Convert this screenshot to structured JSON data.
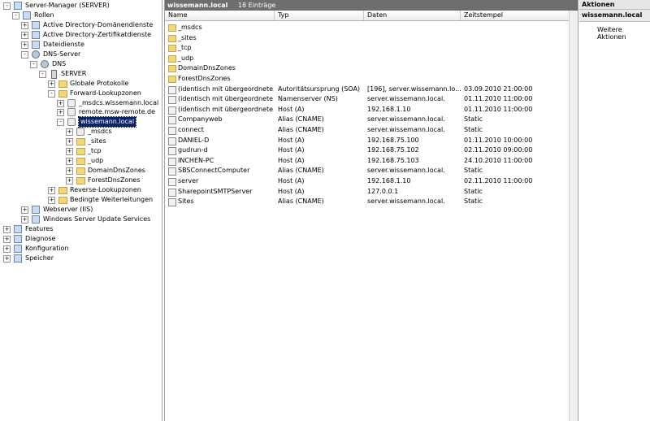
{
  "tree": [
    {
      "label": "Server-Manager (SERVER)",
      "depth": 0,
      "expander": "-",
      "icon": "server-manager-icon"
    },
    {
      "label": "Rollen",
      "depth": 1,
      "expander": "-",
      "icon": "roles-icon"
    },
    {
      "label": "Active Directory-Domänendienste",
      "depth": 2,
      "expander": "+",
      "icon": "ad-ds-icon"
    },
    {
      "label": "Active Directory-Zertifikatdienste",
      "depth": 2,
      "expander": "+",
      "icon": "ad-cs-icon"
    },
    {
      "label": "Dateidienste",
      "depth": 2,
      "expander": "+",
      "icon": "file-services-icon"
    },
    {
      "label": "DNS-Server",
      "depth": 2,
      "expander": "-",
      "icon": "dns-server-icon"
    },
    {
      "label": "DNS",
      "depth": 3,
      "expander": "-",
      "icon": "dns-icon"
    },
    {
      "label": "SERVER",
      "depth": 4,
      "expander": "-",
      "icon": "server-icon"
    },
    {
      "label": "Globale Protokolle",
      "depth": 5,
      "expander": "+",
      "icon": "logs-folder-icon"
    },
    {
      "label": "Forward-Lookupzonen",
      "depth": 5,
      "expander": "-",
      "icon": "folder-icon"
    },
    {
      "label": "_msdcs.wissemann.local",
      "depth": 6,
      "expander": "+",
      "icon": "zone-icon"
    },
    {
      "label": "remote.msw-remote.de",
      "depth": 6,
      "expander": "+",
      "icon": "zone-icon"
    },
    {
      "label": "wissemann.local",
      "depth": 6,
      "expander": "-",
      "icon": "zone-icon",
      "selected": true
    },
    {
      "label": "_msdcs",
      "depth": 7,
      "expander": "+",
      "icon": "zone-icon"
    },
    {
      "label": "_sites",
      "depth": 7,
      "expander": "+",
      "icon": "folder-icon"
    },
    {
      "label": "_tcp",
      "depth": 7,
      "expander": "+",
      "icon": "folder-icon"
    },
    {
      "label": "_udp",
      "depth": 7,
      "expander": "+",
      "icon": "folder-icon"
    },
    {
      "label": "DomainDnsZones",
      "depth": 7,
      "expander": "+",
      "icon": "folder-icon"
    },
    {
      "label": "ForestDnsZones",
      "depth": 7,
      "expander": "+",
      "icon": "folder-icon"
    },
    {
      "label": "Reverse-Lookupzonen",
      "depth": 5,
      "expander": "+",
      "icon": "folder-icon"
    },
    {
      "label": "Bedingte Weiterleitungen",
      "depth": 5,
      "expander": "+",
      "icon": "folder-icon"
    },
    {
      "label": "Webserver (IIS)",
      "depth": 2,
      "expander": "+",
      "icon": "iis-icon"
    },
    {
      "label": "Windows Server Update Services",
      "depth": 2,
      "expander": "+",
      "icon": "wsus-icon"
    },
    {
      "label": "Features",
      "depth": 0,
      "expander": "+",
      "icon": "features-icon"
    },
    {
      "label": "Diagnose",
      "depth": 0,
      "expander": "+",
      "icon": "diagnostics-icon"
    },
    {
      "label": "Konfiguration",
      "depth": 0,
      "expander": "+",
      "icon": "configuration-icon"
    },
    {
      "label": "Speicher",
      "depth": 0,
      "expander": "+",
      "icon": "storage-icon"
    }
  ],
  "main": {
    "title": "wissemann.local",
    "count": "18 Einträge",
    "columns": [
      "Name",
      "Typ",
      "Daten",
      "Zeitstempel"
    ],
    "rows": [
      {
        "icon": "folder-icon",
        "kind": "folder",
        "name": "_msdcs",
        "typ": "",
        "daten": "",
        "zeit": ""
      },
      {
        "icon": "folder-icon",
        "kind": "folder",
        "name": "_sites",
        "typ": "",
        "daten": "",
        "zeit": ""
      },
      {
        "icon": "folder-icon",
        "kind": "folder",
        "name": "_tcp",
        "typ": "",
        "daten": "",
        "zeit": ""
      },
      {
        "icon": "folder-icon",
        "kind": "folder",
        "name": "_udp",
        "typ": "",
        "daten": "",
        "zeit": ""
      },
      {
        "icon": "folder-icon",
        "kind": "folder",
        "name": "DomainDnsZones",
        "typ": "",
        "daten": "",
        "zeit": ""
      },
      {
        "icon": "folder-icon",
        "kind": "folder",
        "name": "ForestDnsZones",
        "typ": "",
        "daten": "",
        "zeit": ""
      },
      {
        "icon": "record-icon",
        "kind": "record",
        "name": "(identisch mit übergeordnete...",
        "typ": "Autoritätsursprung (SOA)",
        "daten": "[196], server.wissemann.lo...",
        "zeit": "03.09.2010 21:00:00"
      },
      {
        "icon": "record-icon",
        "kind": "record",
        "name": "(identisch mit übergeordnete...",
        "typ": "Namenserver (NS)",
        "daten": "server.wissemann.local.",
        "zeit": "01.11.2010 11:00:00"
      },
      {
        "icon": "record-icon",
        "kind": "record",
        "name": "(identisch mit übergeordnete...",
        "typ": "Host (A)",
        "daten": "192.168.1.10",
        "zeit": "01.11.2010 11:00:00"
      },
      {
        "icon": "record-icon",
        "kind": "record",
        "name": "Companyweb",
        "typ": "Alias (CNAME)",
        "daten": "server.wissemann.local.",
        "zeit": "Static"
      },
      {
        "icon": "record-icon",
        "kind": "record",
        "name": "connect",
        "typ": "Alias (CNAME)",
        "daten": "server.wissemann.local.",
        "zeit": "Static"
      },
      {
        "icon": "record-icon",
        "kind": "record",
        "name": "DANIEL-D",
        "typ": "Host (A)",
        "daten": "192.168.75.100",
        "zeit": "01.11.2010 10:00:00"
      },
      {
        "icon": "record-icon",
        "kind": "record",
        "name": "gudrun-d",
        "typ": "Host (A)",
        "daten": "192.168.75.102",
        "zeit": "02.11.2010 09:00:00"
      },
      {
        "icon": "record-icon",
        "kind": "record",
        "name": "INCHEN-PC",
        "typ": "Host (A)",
        "daten": "192.168.75.103",
        "zeit": "24.10.2010 11:00:00"
      },
      {
        "icon": "record-icon",
        "kind": "record",
        "name": "SBSConnectComputer",
        "typ": "Alias (CNAME)",
        "daten": "server.wissemann.local.",
        "zeit": "Static"
      },
      {
        "icon": "record-icon",
        "kind": "record",
        "name": "server",
        "typ": "Host (A)",
        "daten": "192.168.1.10",
        "zeit": "02.11.2010 11:00:00"
      },
      {
        "icon": "record-icon",
        "kind": "record",
        "name": "SharepointSMTPServer",
        "typ": "Host (A)",
        "daten": "127.0.0.1",
        "zeit": "Static"
      },
      {
        "icon": "record-icon",
        "kind": "record",
        "name": "Sites",
        "typ": "Alias (CNAME)",
        "daten": "server.wissemann.local.",
        "zeit": "Static"
      }
    ]
  },
  "actions": {
    "title": "Aktionen",
    "section": "wissemann.local",
    "item": "Weitere Aktionen"
  }
}
